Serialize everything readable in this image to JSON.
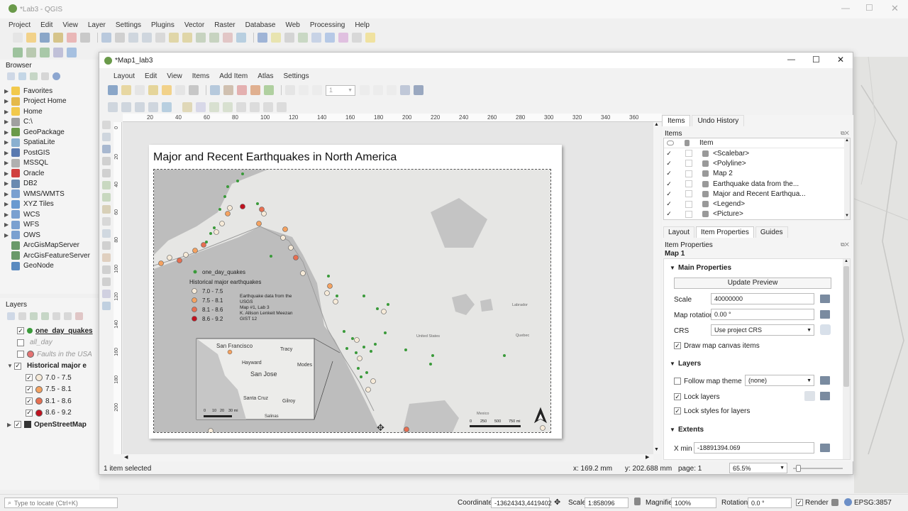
{
  "qgis": {
    "title": "*Lab3 - QGIS",
    "menus": [
      "Project",
      "Edit",
      "View",
      "Layer",
      "Settings",
      "Plugins",
      "Vector",
      "Raster",
      "Database",
      "Web",
      "Processing",
      "Help"
    ]
  },
  "browser": {
    "title": "Browser",
    "items": [
      "Favorites",
      "Project Home",
      "Home",
      "C:\\",
      "GeoPackage",
      "SpatiaLite",
      "PostGIS",
      "MSSQL",
      "Oracle",
      "DB2",
      "WMS/WMTS",
      "XYZ Tiles",
      "WCS",
      "WFS",
      "OWS",
      "ArcGisMapServer",
      "ArcGisFeatureServer",
      "GeoNode"
    ]
  },
  "layers": {
    "title": "Layers",
    "items": [
      {
        "label": "one_day_quakes",
        "checked": true
      },
      {
        "label": "all_day",
        "checked": false
      },
      {
        "label": "Faults in the USA",
        "checked": false
      },
      {
        "label": "Historical major e",
        "checked": true
      },
      {
        "label": "7.0 - 7.5",
        "checked": true
      },
      {
        "label": "7.5 - 8.1",
        "checked": true
      },
      {
        "label": "8.1 - 8.6",
        "checked": true
      },
      {
        "label": "8.6 - 9.2",
        "checked": true
      },
      {
        "label": "OpenStreetMap",
        "checked": true
      }
    ]
  },
  "status": {
    "locate_placeholder": "Type to locate (Ctrl+K)",
    "coordinate_label": "Coordinate",
    "coordinate": "-13624343,4419402",
    "scale_label": "Scale",
    "scale": "1:858096",
    "magnifier_label": "Magnifier",
    "magnifier": "100%",
    "rotation_label": "Rotation",
    "rotation": "0.0 °",
    "render_label": "Render",
    "crs": "EPSG:3857"
  },
  "layout": {
    "title": "*Map1_lab3",
    "menus": [
      "Layout",
      "Edit",
      "View",
      "Items",
      "Add Item",
      "Atlas",
      "Settings"
    ],
    "page_field": "1",
    "ruler_h": [
      "0",
      "20",
      "40",
      "60",
      "80",
      "100",
      "120",
      "140",
      "160",
      "180",
      "200",
      "220",
      "240",
      "260",
      "280",
      "300",
      "320",
      "340",
      "360"
    ],
    "ruler_v": [
      "0",
      "20",
      "40",
      "60",
      "80",
      "100",
      "120",
      "140",
      "160",
      "180",
      "200"
    ],
    "status": {
      "selected": "1 item selected",
      "x": "x: 169.2 mm",
      "y": "y: 202.688 mm",
      "page": "page: 1",
      "zoom": "65.5%"
    }
  },
  "map": {
    "title": "Major and Recent Earthquakes in North America",
    "legend": {
      "one_day": "one_day_quakes",
      "historical": "Historical major earthquakes",
      "classes": [
        "7.0 - 7.5",
        "7.5 - 8.1",
        "8.1 - 8.6",
        "8.6 - 9.2"
      ]
    },
    "credit": [
      "Earthquake data from the",
      "USGS",
      "Map #1, Lab 3",
      "K. Allison Lenkeit Meezan",
      "GIST 12"
    ],
    "inset": {
      "labels": [
        "San Francisco",
        "Tracy",
        "Hayward",
        "San Jose",
        "Modes",
        "Santa Cruz",
        "Gilroy",
        "Salinas"
      ],
      "scale": [
        "0",
        "10",
        "20",
        "30 mi"
      ]
    },
    "scale_labels": [
      "0",
      "250",
      "500",
      "750 mi"
    ],
    "places": [
      "Labrador",
      "Quebec",
      "United States",
      "Mexico"
    ],
    "colors": {
      "one_day": "#3a9a3a",
      "c1": "#f6ead8",
      "c2": "#f4a261",
      "c3": "#e76f51",
      "c4": "#c1121f"
    }
  },
  "panel": {
    "tabs": [
      "Items",
      "Undo History"
    ],
    "items_title": "Items",
    "column": "Item",
    "items": [
      "<Scalebar>",
      "<Polyline>",
      "Map 2",
      "Earthquake data from the...",
      "Major and Recent Earthqua...",
      "<Legend>",
      "<Picture>"
    ],
    "prop_tabs": [
      "Layout",
      "Item Properties",
      "Guides"
    ],
    "props_title": "Item Properties",
    "map_name": "Map 1",
    "main_section": "Main Properties",
    "update_preview": "Update Preview",
    "scale_label": "Scale",
    "scale": "40000000",
    "rotation_label": "Map rotation",
    "rotation": "0.00 °",
    "crs_label": "CRS",
    "crs": "Use project CRS",
    "draw_items": "Draw map canvas items",
    "layers_section": "Layers",
    "follow_theme": "Follow map theme",
    "theme": "(none)",
    "lock_layers": "Lock layers",
    "lock_styles": "Lock styles for layers",
    "extents_section": "Extents",
    "xmin_label": "X min",
    "xmin": "-18891394.069"
  }
}
